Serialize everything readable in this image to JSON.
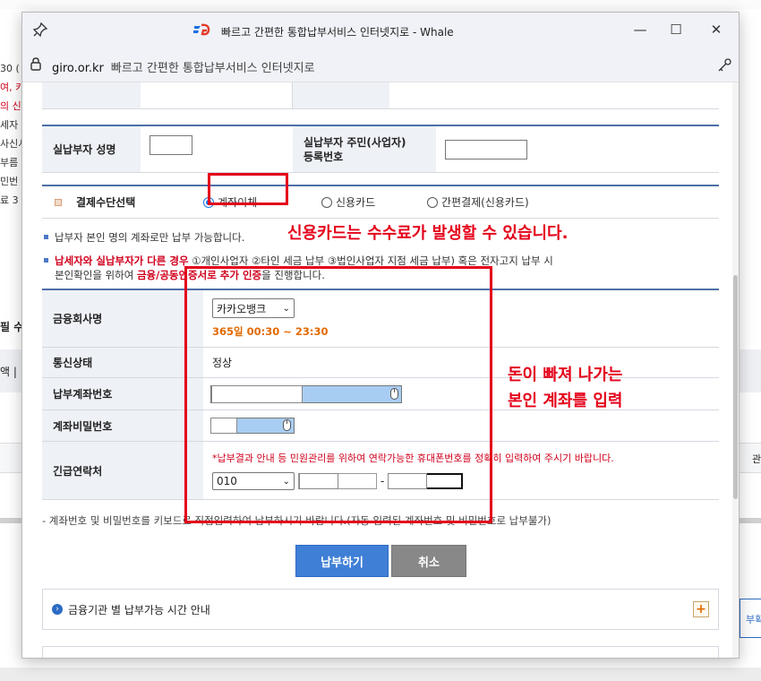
{
  "background": {
    "left_fragments": [
      "30 (",
      "여, 카",
      "의 신",
      "세자 5",
      "사신서",
      "부름",
      "민번",
      "료 3"
    ],
    "fragment_side_1": "필 수",
    "fragment_side_2": "액 |",
    "fragment_right_cell": "관",
    "fragment_right_button": "부확인"
  },
  "window": {
    "title": "빠르고 간편한 통합납부서비스 인터넷지로 - Whale",
    "logo": "G",
    "minimize": "—",
    "maximize": "☐",
    "close": "✕"
  },
  "address": {
    "host": "giro.or.kr",
    "page_title": "빠르고 간편한 통합납부서비스 인터넷지로"
  },
  "form": {
    "payer_name_label": "실납부자 성명",
    "payer_id_label_1": "실납부자 주민(사업자)",
    "payer_id_label_2": "등록번호",
    "payment_method_label": "결제수단선택",
    "methods": {
      "transfer": "계좌이체",
      "card": "신용카드",
      "easy": "간편결제(신용카드)"
    },
    "selected_method": "계좌이체",
    "note_1": "납부자 본인 명의 계좌로만 납부 가능합니다.",
    "note_2_red": "납세자와 실납부자가 다른 경우",
    "note_2_rest": " ①개인사업자 ②타인 세금 납부 ③법인사업자 지점 세금 납부) 혹은 전자고지 납부 시",
    "note_3_pre": "본인확인을 위하여 ",
    "note_3_red": "금융/공동인증서로 추가 인증",
    "note_3_post": "을 진행합니다.",
    "bank_label": "금융회사명",
    "bank_selected": "카카오뱅크",
    "bank_hours": "365일 00:30 ~ 23:30",
    "status_label": "통신상태",
    "status_value": "정상",
    "account_label": "납부계좌번호",
    "password_label": "계좌비밀번호",
    "contact_label": "긴급연락처",
    "contact_notice": "*납부결과 안내 등 민원관리를 위하여 연락가능한 휴대폰번호를 정확히 입력하여 주시기 바랍니다.",
    "phone_prefix": "010",
    "dash": "-",
    "bottom_note": "- 계좌번호 및 비밀번호를 키보드로 직접입력하여 납부하시기 바랍니다.(자동 입력된 계좌번호 및 비밀번호로 납부불가)"
  },
  "annotations": {
    "card_fee": "신용카드는 수수료가 발생할 수 있습니다.",
    "account_line1": "돈이 빠져 나가는",
    "account_line2": "본인 계좌를 입력"
  },
  "buttons": {
    "pay": "납부하기",
    "cancel": "취소"
  },
  "info": {
    "time_guide": "금융기관 별 납부가능 시간 안내",
    "expand": "+"
  },
  "colors": {
    "accent": "#4e6fa8",
    "annotation_red": "#e4001a",
    "pay_button": "#3f7fd6",
    "masked_field": "#a8cdf2"
  }
}
